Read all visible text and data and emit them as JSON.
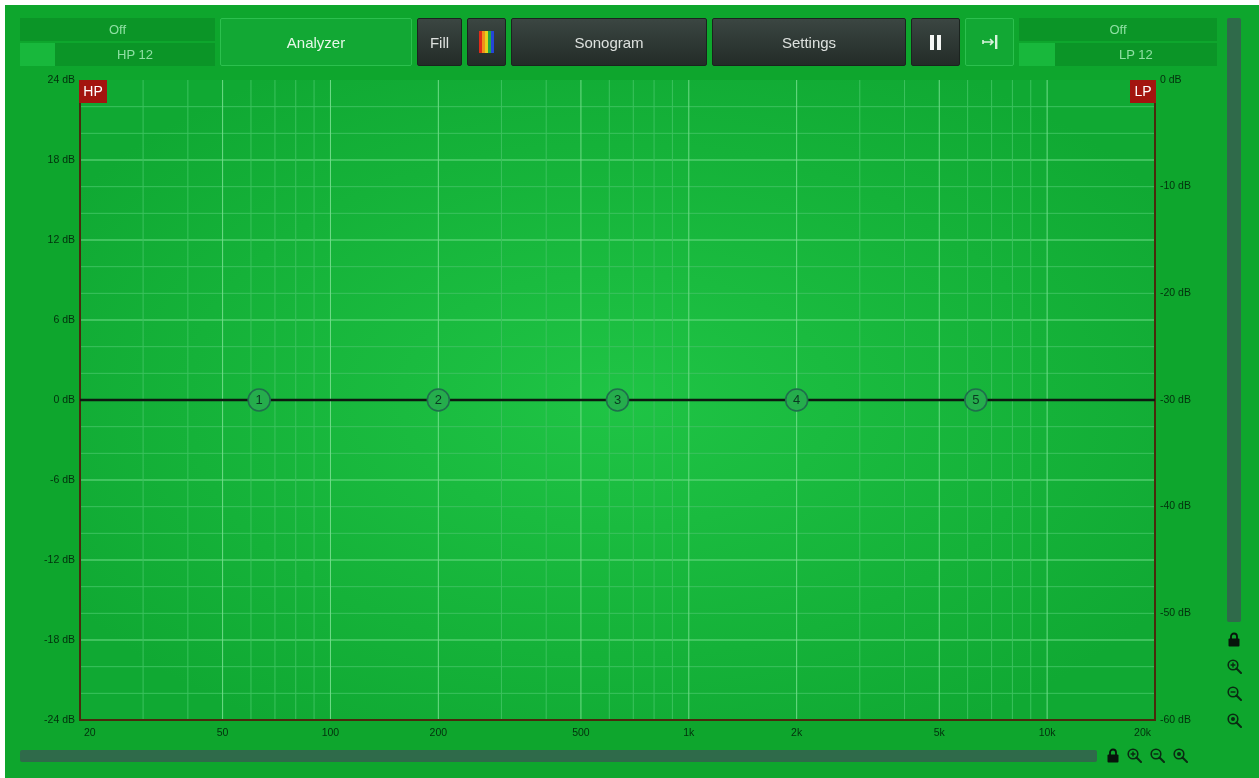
{
  "header": {
    "highpass": {
      "label": "Off",
      "slope": "HP 12",
      "level": 0.18
    },
    "buttons": [
      {
        "kind": "text",
        "label": "Analyzer",
        "on": true
      },
      {
        "kind": "text",
        "label": "Fill",
        "on": false
      },
      {
        "kind": "colors",
        "on": false
      },
      {
        "kind": "text",
        "label": "Sonogram",
        "on": false
      },
      {
        "kind": "text",
        "label": "Settings",
        "on": false
      },
      {
        "kind": "pause",
        "on": false
      },
      {
        "kind": "collapse",
        "on": true
      }
    ],
    "lowpass": {
      "label": "Off",
      "slope": "LP 12",
      "level": 0.18
    }
  },
  "graph": {
    "chart_data": [
      {
        "type": "line",
        "x": [
          20,
          20000
        ],
        "values": [
          0,
          0
        ],
        "color": "#0d1a10",
        "xlim": [
          20,
          20000
        ],
        "ylim": [
          -24,
          24
        ],
        "y2lim": [
          -60,
          0
        ],
        "log": "x",
        "grid": true,
        "xticks": [
          {
            "value": 20,
            "label": "20"
          },
          {
            "value": 50,
            "label": "50"
          },
          {
            "value": 100,
            "label": "100"
          },
          {
            "value": 200,
            "label": "200"
          },
          {
            "value": 500,
            "label": "500"
          },
          {
            "value": 1000,
            "label": "1k"
          },
          {
            "value": 2000,
            "label": "2k"
          },
          {
            "value": 5000,
            "label": "5k"
          },
          {
            "value": 10000,
            "label": "10k"
          },
          {
            "value": 20000,
            "label": "20k"
          }
        ],
        "yticks": [
          {
            "value": 24,
            "label": "24 dB"
          },
          {
            "value": 18,
            "label": "18 dB"
          },
          {
            "value": 12,
            "label": "12 dB"
          },
          {
            "value": 6,
            "label": "6 dB"
          },
          {
            "value": 0,
            "label": "0 dB"
          },
          {
            "value": -6,
            "label": "-6 dB"
          },
          {
            "value": -12,
            "label": "-12 dB"
          },
          {
            "value": -18,
            "label": "-18 dB"
          },
          {
            "value": -24,
            "label": "-24 dB"
          }
        ],
        "y2ticks": [
          {
            "value": 0,
            "label": "0 dB"
          },
          {
            "value": -10,
            "label": "-10 dB"
          },
          {
            "value": -20,
            "label": "-20 dB"
          },
          {
            "value": -30,
            "label": "-30 dB"
          },
          {
            "value": -40,
            "label": "-40 dB"
          },
          {
            "value": -50,
            "label": "-50 dB"
          },
          {
            "value": -60,
            "label": "-60 dB"
          }
        ]
      }
    ],
    "highpass_handle": {
      "label": "HP"
    },
    "lowpass_handle": {
      "label": "LP"
    },
    "band_nodes": [
      {
        "label": "1"
      },
      {
        "label": "2"
      },
      {
        "label": "3"
      },
      {
        "label": "4"
      },
      {
        "label": "5"
      }
    ]
  }
}
